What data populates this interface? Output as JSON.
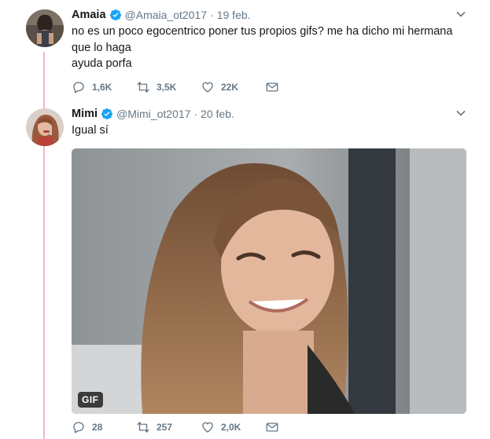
{
  "tweets": [
    {
      "name": "Amaia",
      "handle": "@Amaia_ot2017",
      "separator": "·",
      "date": "19 feb.",
      "lines": [
        "no es un poco egocentrico poner tus propios gifs? me ha dicho mi hermana",
        "que lo haga",
        "ayuda porfa"
      ],
      "replies": "1,6K",
      "retweets": "3,5K",
      "likes": "22K"
    },
    {
      "name": "Mimi",
      "handle": "@Mimi_ot2017",
      "separator": "·",
      "date": "20 feb.",
      "lines": [
        "Igual sí"
      ],
      "media_badge": "GIF",
      "replies": "28",
      "retweets": "257",
      "likes": "2,0K"
    }
  ],
  "icons": {
    "verified": "verified-badge-icon",
    "reply": "reply-icon",
    "retweet": "retweet-icon",
    "like": "heart-icon",
    "dm": "envelope-icon",
    "menu": "chevron-down-icon"
  },
  "colors": {
    "verified": "#1da1f2",
    "thread_line": "#f7b3c9",
    "muted": "#657786",
    "text": "#14171a"
  }
}
